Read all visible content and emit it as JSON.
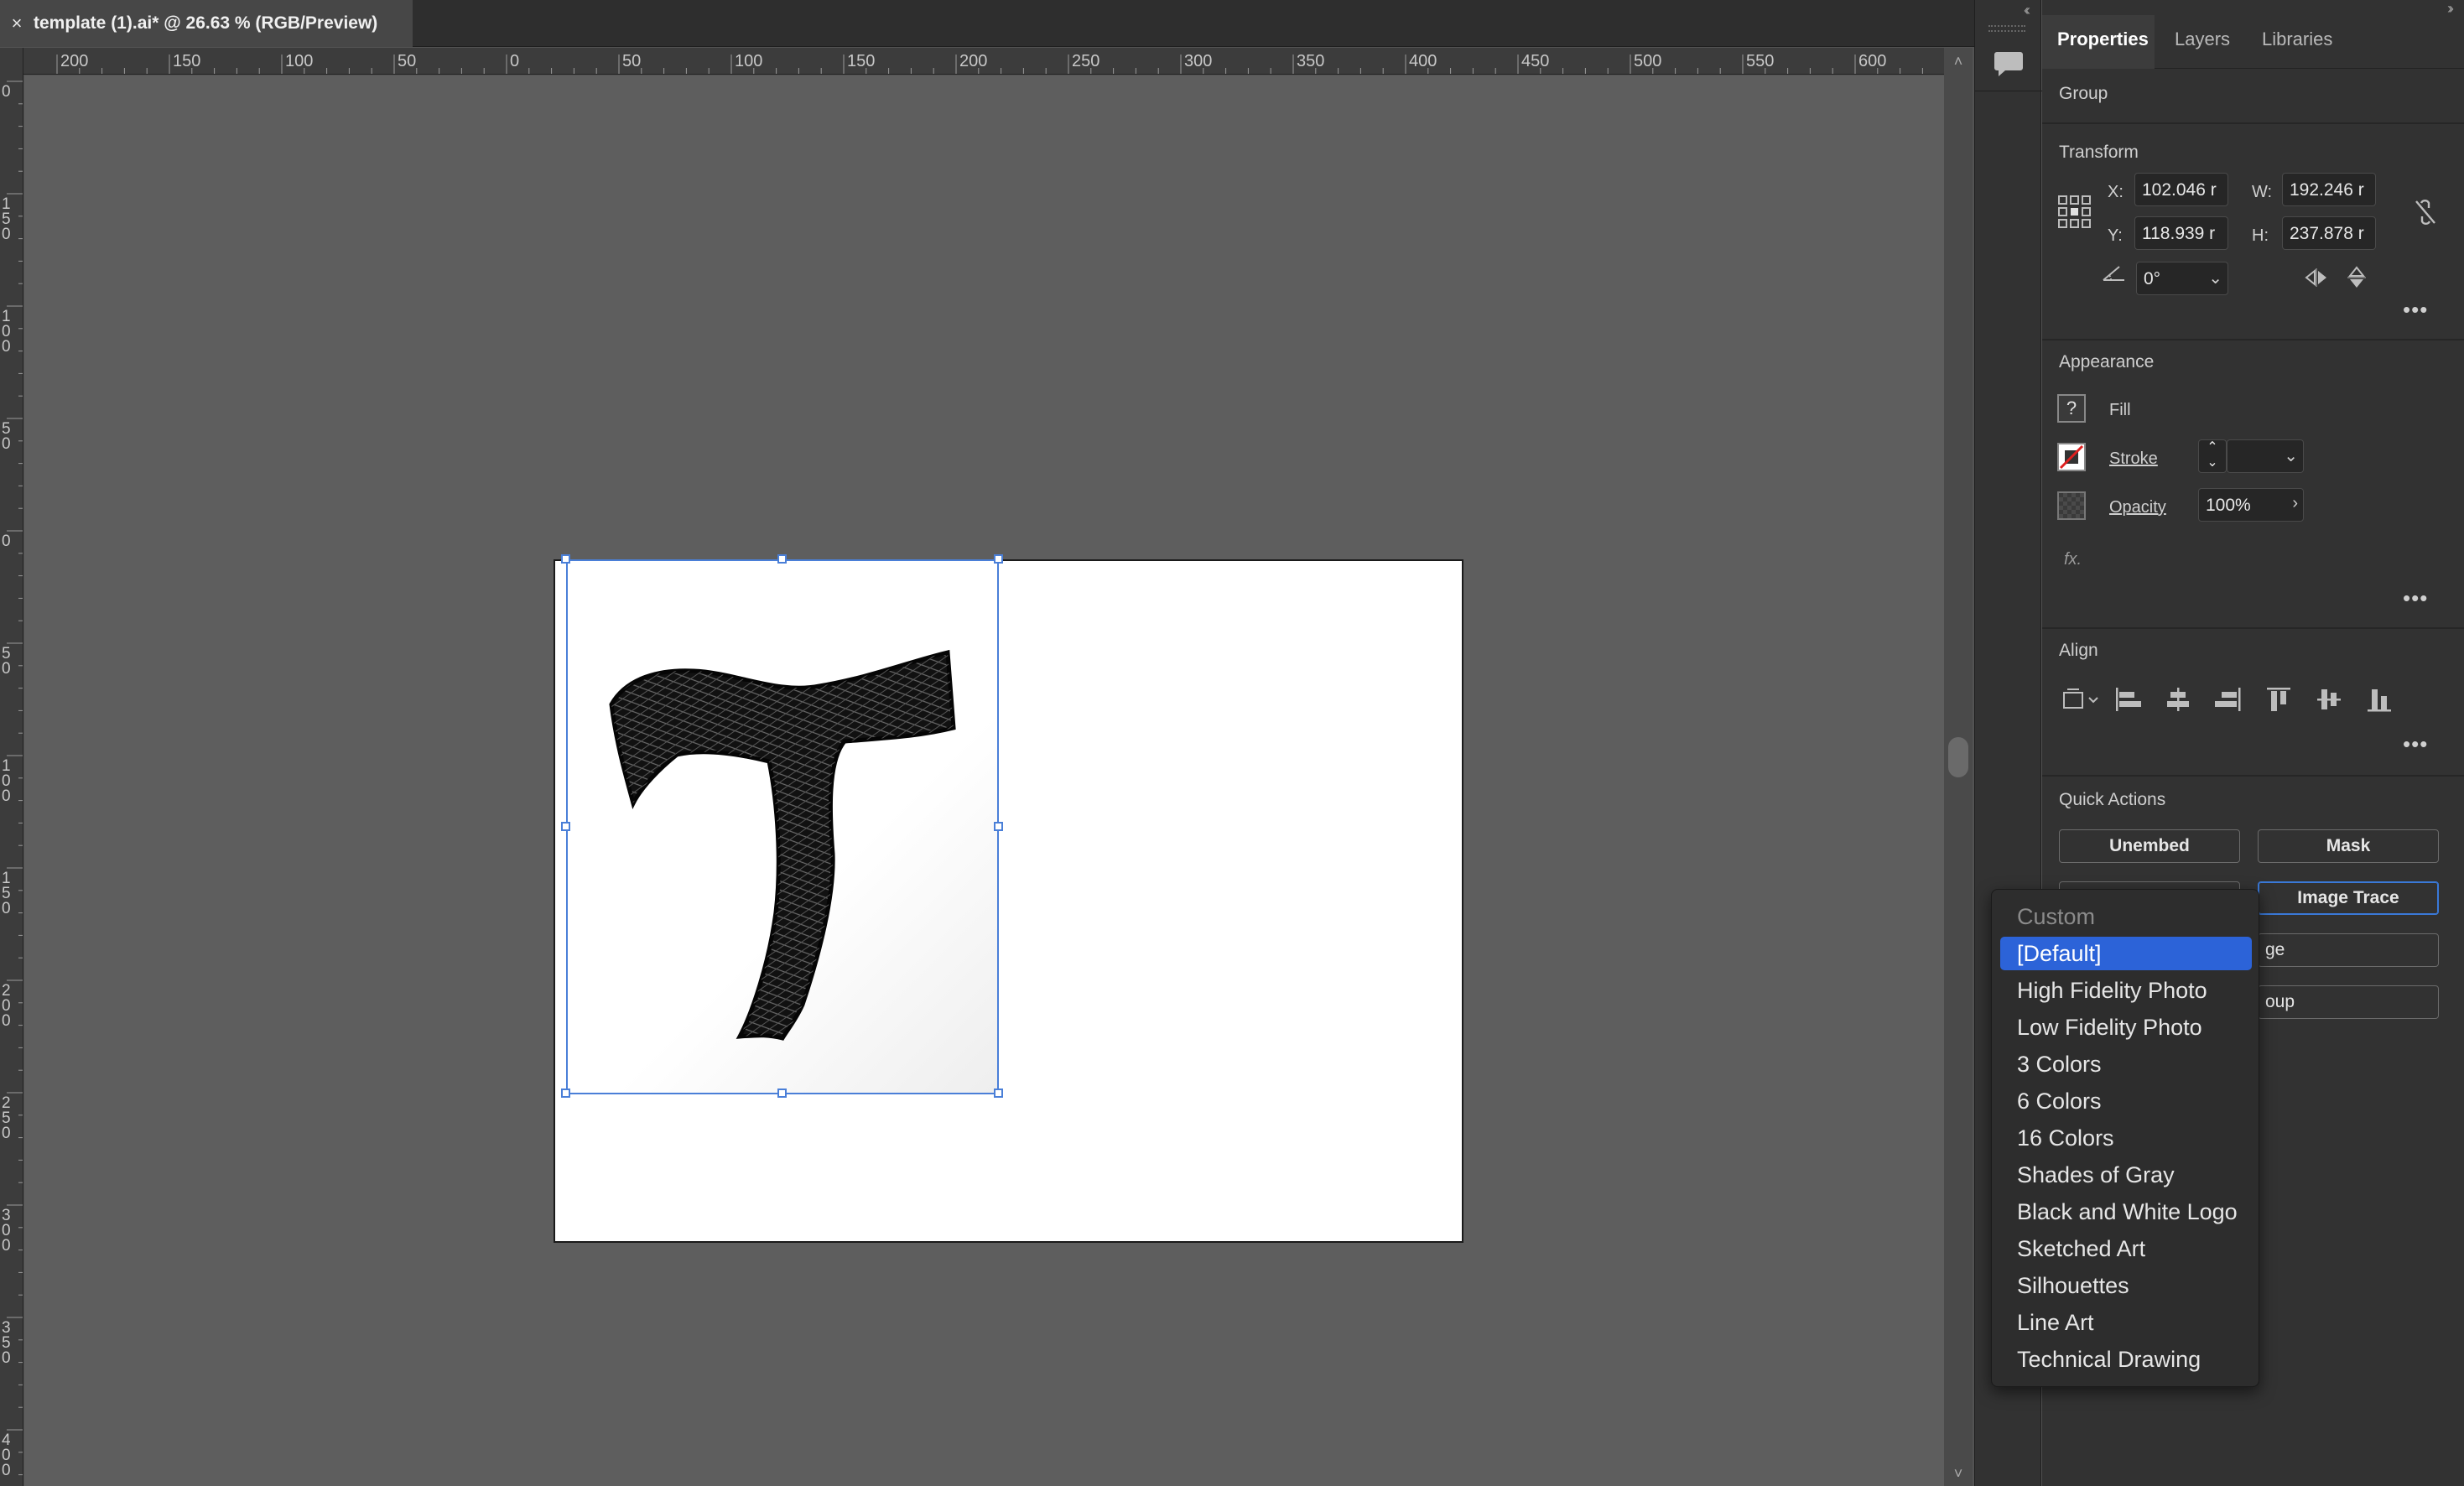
{
  "document": {
    "tab_title": "template (1).ai* @ 26.63 % (RGB/Preview)",
    "close_glyph": "×"
  },
  "rulers": {
    "top_ticks": [
      "200",
      "150",
      "100",
      "50",
      "0",
      "50",
      "100",
      "150",
      "200",
      "250",
      "300",
      "350",
      "400",
      "450",
      "500",
      "550",
      "600"
    ],
    "left_ticks": [
      "0",
      "1 5 0",
      "1 0 0",
      "5 0",
      "0",
      "5 0",
      "1 0 0",
      "1 5 0",
      "2 0 0",
      "2 5 0",
      "3 0 0",
      "3 5 0",
      "4 0 0"
    ]
  },
  "panel": {
    "tabs": [
      "Properties",
      "Layers",
      "Libraries"
    ],
    "active_tab": "Properties",
    "selection_type": "Group",
    "transform": {
      "title": "Transform",
      "x_label": "X:",
      "x_value": "102.046 r",
      "y_label": "Y:",
      "y_value": "118.939 r",
      "w_label": "W:",
      "w_value": "192.246 r",
      "h_label": "H:",
      "h_value": "237.878 r",
      "angle_value": "0°"
    },
    "appearance": {
      "title": "Appearance",
      "fill_label": "Fill",
      "fill_swatch": "?",
      "stroke_label": "Stroke",
      "opacity_label": "Opacity",
      "opacity_value": "100%",
      "fx_label": "fx."
    },
    "align": {
      "title": "Align"
    },
    "quick_actions": {
      "title": "Quick Actions",
      "unembed": "Unembed",
      "mask": "Mask",
      "image_trace": "Image Trace",
      "crop_image_partial": "ge",
      "ungroup_partial": "oup"
    }
  },
  "trace_menu": {
    "header": "Custom",
    "selected": "[Default]",
    "items": [
      "[Default]",
      "High Fidelity Photo",
      "Low Fidelity Photo",
      "3 Colors",
      "6 Colors",
      "16 Colors",
      "Shades of Gray",
      "Black and White Logo",
      "Sketched Art",
      "Silhouettes",
      "Line Art",
      "Technical Drawing"
    ]
  },
  "colors": {
    "selection_blue": "#4a7fd8",
    "menu_highlight": "#2c63d8",
    "canvas_bg": "#5e5e5e",
    "panel_bg": "#323232"
  }
}
